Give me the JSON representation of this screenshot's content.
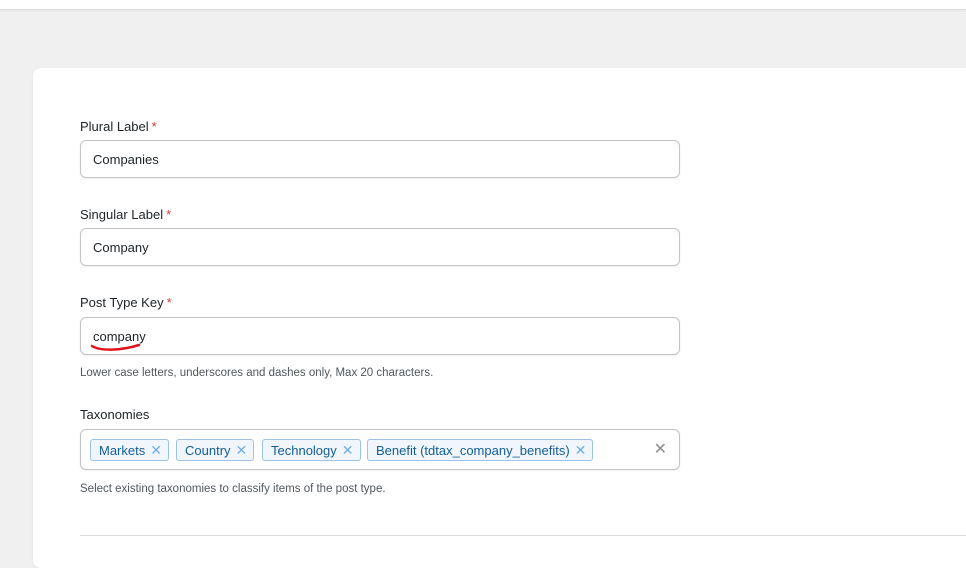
{
  "form": {
    "plural": {
      "label": "Plural Label",
      "required_mark": "*",
      "value": "Companies"
    },
    "singular": {
      "label": "Singular Label",
      "required_mark": "*",
      "value": "Company"
    },
    "post_type_key": {
      "label": "Post Type Key",
      "required_mark": "*",
      "value": "company",
      "hint": "Lower case letters, underscores and dashes only, Max 20 characters."
    },
    "taxonomies": {
      "label": "Taxonomies",
      "tags": [
        {
          "label": "Markets",
          "remove": "✕"
        },
        {
          "label": "Country",
          "remove": "✕"
        },
        {
          "label": "Technology",
          "remove": "✕"
        },
        {
          "label": "Benefit (tdtax_company_benefits)",
          "remove": "✕"
        }
      ],
      "clear": "✕",
      "hint": "Select existing taxonomies to classify items of the post type."
    }
  },
  "colors": {
    "required": "#d63638",
    "tag_bg": "#f0f6fc",
    "tag_border": "#9ec2e6",
    "tag_text": "#135e96",
    "annotation": "#e0141e"
  },
  "icons": {
    "tag_remove": "close-icon",
    "clear_all": "close-icon"
  }
}
